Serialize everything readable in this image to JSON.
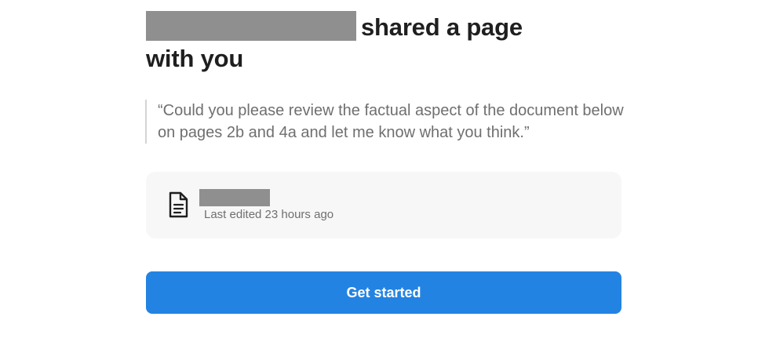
{
  "headline": {
    "sender_redacted": true,
    "text_line": "shared a page",
    "text_line2": "with you"
  },
  "message": {
    "quote": "“Could you please review the factual aspect of the document below on pages 2b and 4a and let me know what you think.”"
  },
  "document": {
    "icon": "document-icon",
    "title_redacted": true,
    "meta": "Last edited 23 hours ago"
  },
  "cta": {
    "label": "Get started",
    "color": "#2383e2"
  }
}
